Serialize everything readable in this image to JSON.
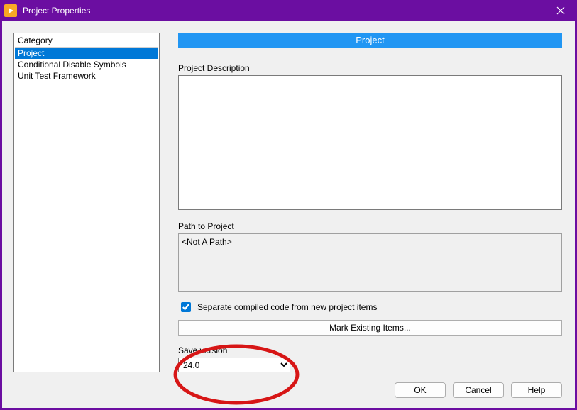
{
  "title": "Project Properties",
  "sidebar": {
    "header": "Category",
    "items": [
      {
        "label": "Project",
        "selected": true
      },
      {
        "label": "Conditional Disable Symbols",
        "selected": false
      },
      {
        "label": "Unit Test Framework",
        "selected": false
      }
    ]
  },
  "panel": {
    "title": "Project",
    "desc_label": "Project Description",
    "desc_value": "",
    "path_label": "Path to Project",
    "path_value": "<Not A Path>",
    "separate_checked": true,
    "separate_label": "Separate compiled code from new project items",
    "mark_button": "Mark Existing Items...",
    "save_version_label": "Save version",
    "save_version_value": "24.0",
    "save_version_options": [
      "24.0"
    ]
  },
  "buttons": {
    "ok": "OK",
    "cancel": "Cancel",
    "help": "Help"
  }
}
